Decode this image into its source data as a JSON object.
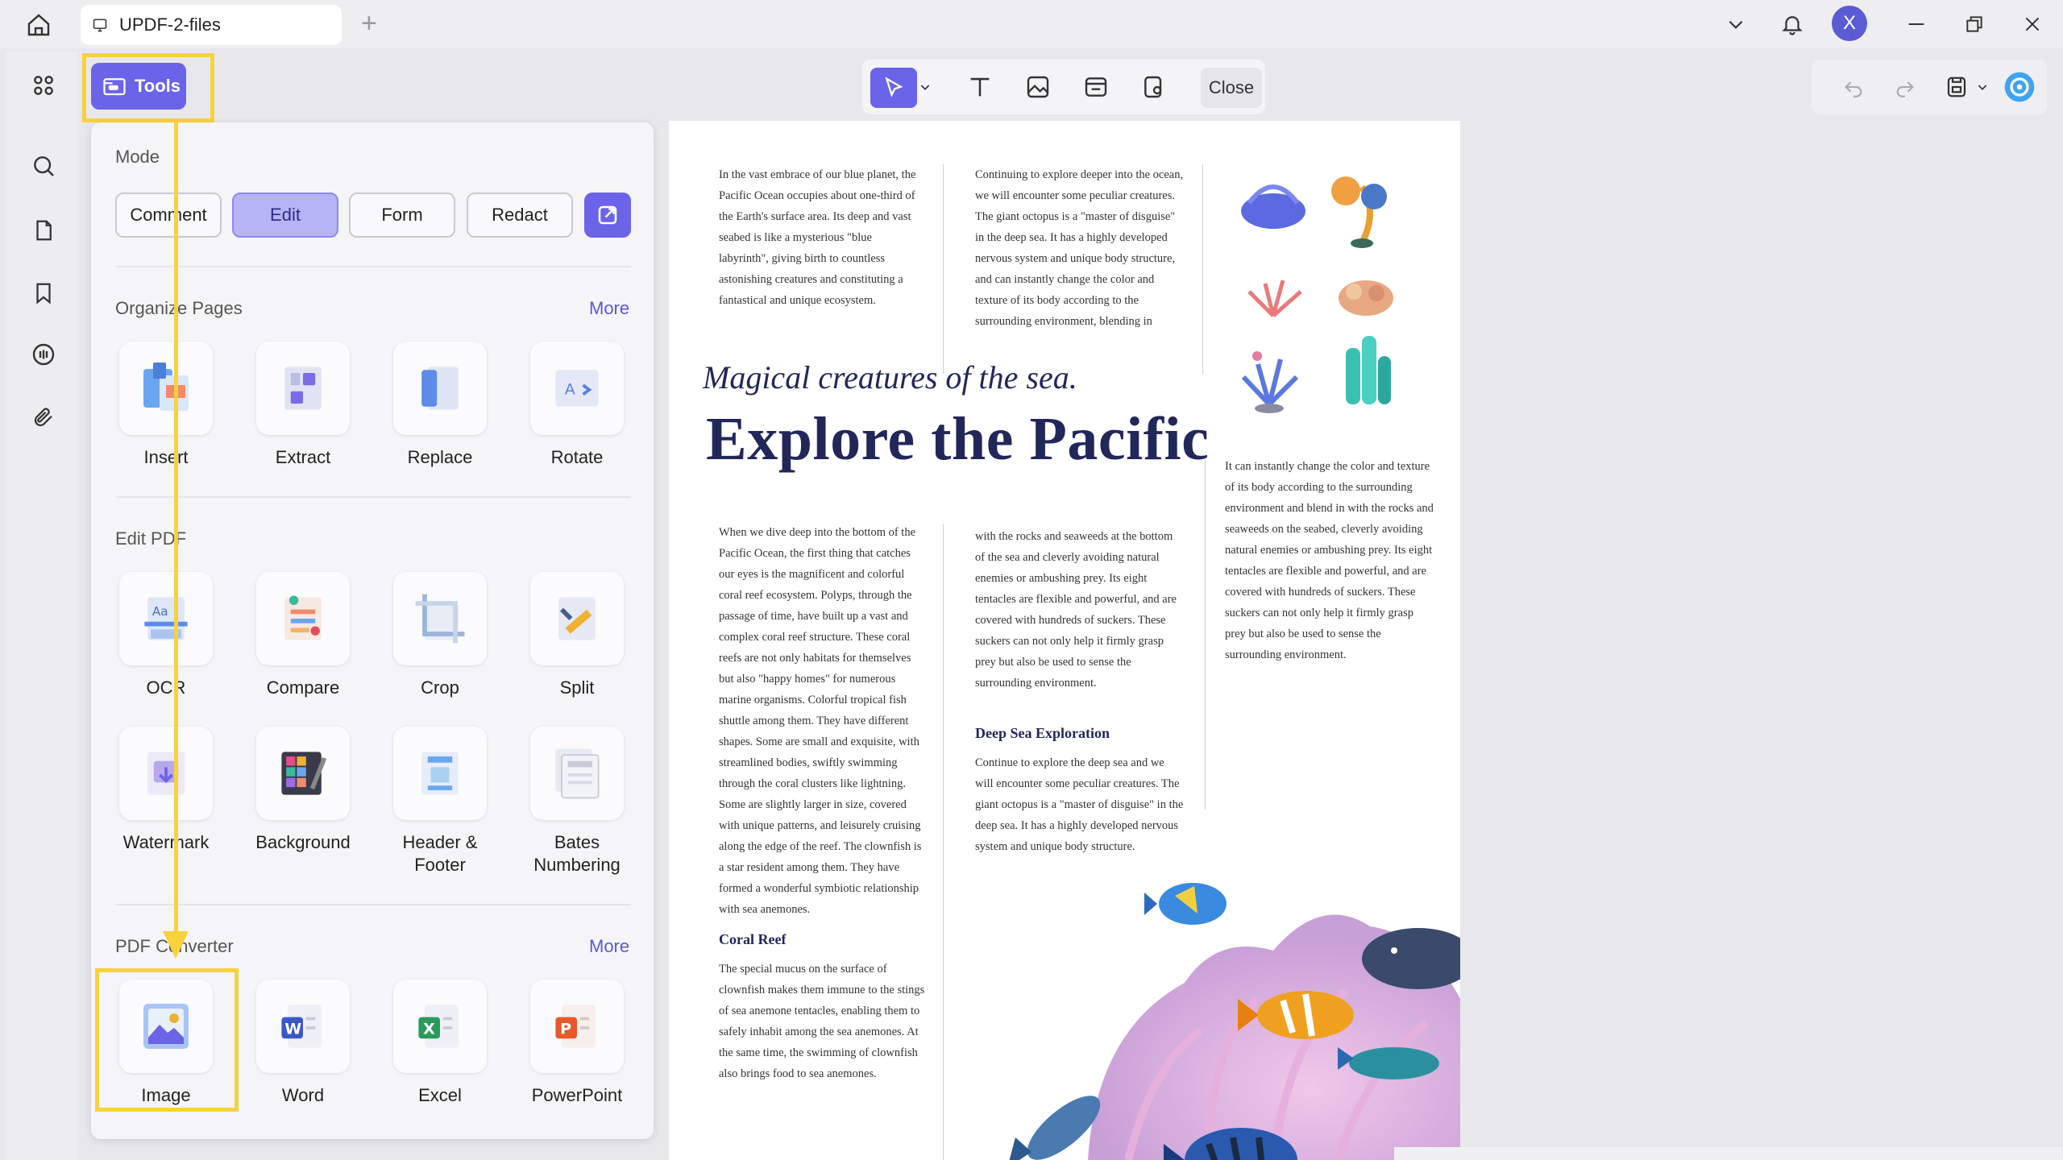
{
  "window": {
    "tab_title": "UPDF-2-files",
    "avatar_letter": "X",
    "accent_color": "#6b63e8",
    "highlight_color": "#f7d23b"
  },
  "rail": [
    "home-icon",
    "grid-icon",
    "search-icon",
    "pages-icon",
    "bookmark-icon",
    "comment-icon",
    "attachment-icon"
  ],
  "tools_button": {
    "label": "Tools"
  },
  "toolbar": {
    "close_label": "Close"
  },
  "panel": {
    "mode_label": "Mode",
    "modes": [
      "Comment",
      "Edit",
      "Form",
      "Redact"
    ],
    "active_mode": "Edit",
    "organize": {
      "label": "Organize Pages",
      "more": "More",
      "items": [
        "Insert",
        "Extract",
        "Replace",
        "Rotate"
      ]
    },
    "edit": {
      "label": "Edit PDF",
      "items": [
        "OCR",
        "Compare",
        "Crop",
        "Split",
        "Watermark",
        "Background",
        "Header & Footer",
        "Bates Numbering"
      ]
    },
    "converter": {
      "label": "PDF Converter",
      "more": "More",
      "items": [
        "Image",
        "Word",
        "Excel",
        "PowerPoint"
      ]
    }
  },
  "document": {
    "col1_top": "In the vast embrace of our blue planet, the Pacific Ocean occupies about one-third of the Earth's surface area. Its deep and vast seabed is like a mysterious \"blue labyrinth\", giving birth to countless astonishing creatures and constituting a fantastical and unique ecosystem.",
    "col2_top": "Continuing to explore deeper into the ocean, we will encounter some peculiar creatures. The giant octopus is a \"master of disguise\" in the deep sea. It has a highly developed nervous system and unique body structure, and can instantly change the color and texture of its body according to the surrounding environment, blending in",
    "subtitle": "Magical creatures of the sea.",
    "title": "Explore the Pacific",
    "col3_mid": "It can instantly change the color and texture of its body according to the surrounding environment and blend in with the rocks and seaweeds on the seabed, cleverly avoiding natural enemies or ambushing prey. Its eight tentacles are flexible and powerful, and are covered with hundreds of suckers. These suckers can not only help it firmly grasp prey but also be used to sense the surrounding environment.",
    "col1_body": "When we dive deep into the bottom of the Pacific Ocean, the first thing that catches our eyes is the magnificent and colorful coral reef ecosystem. Polyps, through the passage of time, have built up a vast and complex coral reef structure. These coral reefs are not only habitats for themselves but also \"happy homes\" for numerous marine organisms. Colorful tropical fish shuttle among them. They have different shapes. Some are small and exquisite, with streamlined bodies, swiftly swimming through the coral clusters like lightning. Some are slightly larger in size, covered with unique patterns, and leisurely cruising along the edge of the reef. The clownfish is a star resident among them. They have formed a wonderful symbiotic relationship with sea anemones.",
    "col2_body": "with the rocks and seaweeds at the bottom of the sea and cleverly avoiding natural enemies or ambushing prey. Its eight tentacles are flexible and powerful, and are covered with hundreds of suckers. These suckers can not only help it firmly grasp prey but also be used to sense the surrounding environment.",
    "deep_sea_heading": "Deep Sea Exploration",
    "deep_sea_text": "Continue to explore the deep sea and we will encounter some peculiar creatures. The giant octopus is a \"master of disguise\" in the deep sea. It has a highly developed nervous system and unique body structure.",
    "coral_reef_heading": "Coral Reef",
    "coral_reef_text": "The special mucus on the surface of clownfish makes them immune to the stings of sea anemone tentacles, enabling them to safely inhabit among the sea anemones. At the same time, the swimming of clownfish also brings food to sea anemones."
  }
}
